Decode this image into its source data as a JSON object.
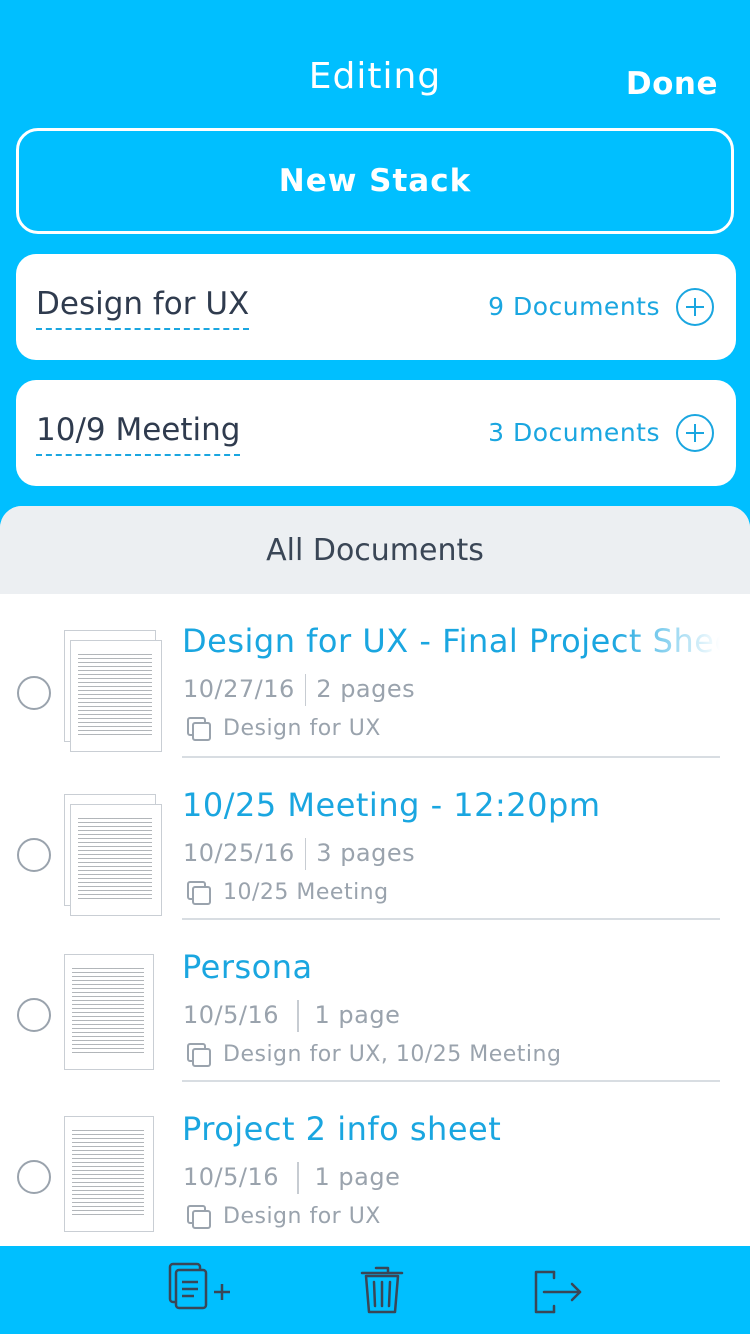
{
  "header": {
    "title": "Editing",
    "done_label": "Done"
  },
  "new_stack_label": "New Stack",
  "stacks": [
    {
      "name": "Design for UX",
      "count": "9 Documents"
    },
    {
      "name": "10/9 Meeting",
      "count": "3 Documents"
    }
  ],
  "all_documents_label": "All Documents",
  "documents": [
    {
      "title": "Design for UX - Final Project Shee",
      "date": "10/27/16",
      "pages": "2 pages",
      "stacks": "Design for UX"
    },
    {
      "title": "10/25 Meeting - 12:20pm",
      "date": "10/25/16",
      "pages": "3 pages",
      "stacks": "10/25 Meeting"
    },
    {
      "title": "Persona",
      "date": "10/5/16",
      "pages": "1 page",
      "stacks": "Design for UX, 10/25 Meeting"
    },
    {
      "title": "Project 2 info sheet",
      "date": "10/5/16",
      "pages": "1 page",
      "stacks": "Design for UX"
    }
  ],
  "toolbar": {
    "icons": [
      "add-to-stack-icon",
      "trash-icon",
      "export-icon"
    ]
  },
  "colors": {
    "accent": "#00bfff",
    "link": "#1aa6e0",
    "muted": "#9aa3ad"
  }
}
